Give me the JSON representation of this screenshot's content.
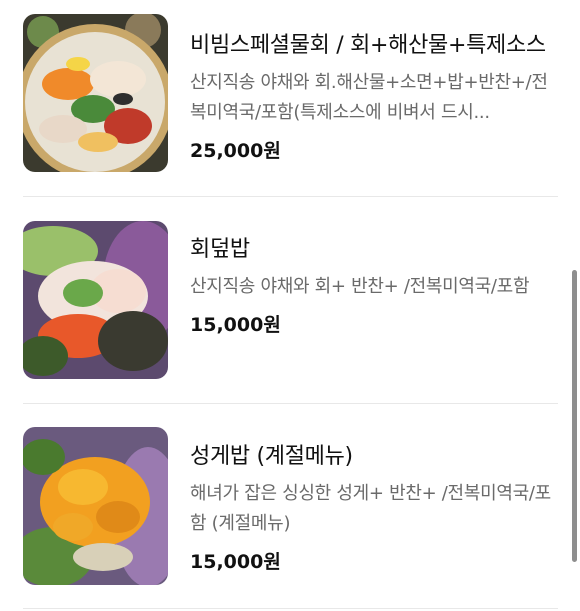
{
  "menu": {
    "items": [
      {
        "name": "비빔스페셜물회 / 회+해산물+특제소스",
        "description": "산지직송 야채와 회.해산물+소면+밥+반찬+/전복미역국/포함(특제소스에 비벼서 드시...",
        "price": "25,000원"
      },
      {
        "name": "회덮밥",
        "description": "산지직송 야채와 회+ 반찬+ /전복미역국/포함",
        "price": "15,000원"
      },
      {
        "name": "성게밥 (계절메뉴)",
        "description": "해녀가 잡은 싱싱한 성게+ 반찬+ /전복미역국/포함 (계절메뉴)",
        "price": "15,000원"
      }
    ]
  }
}
